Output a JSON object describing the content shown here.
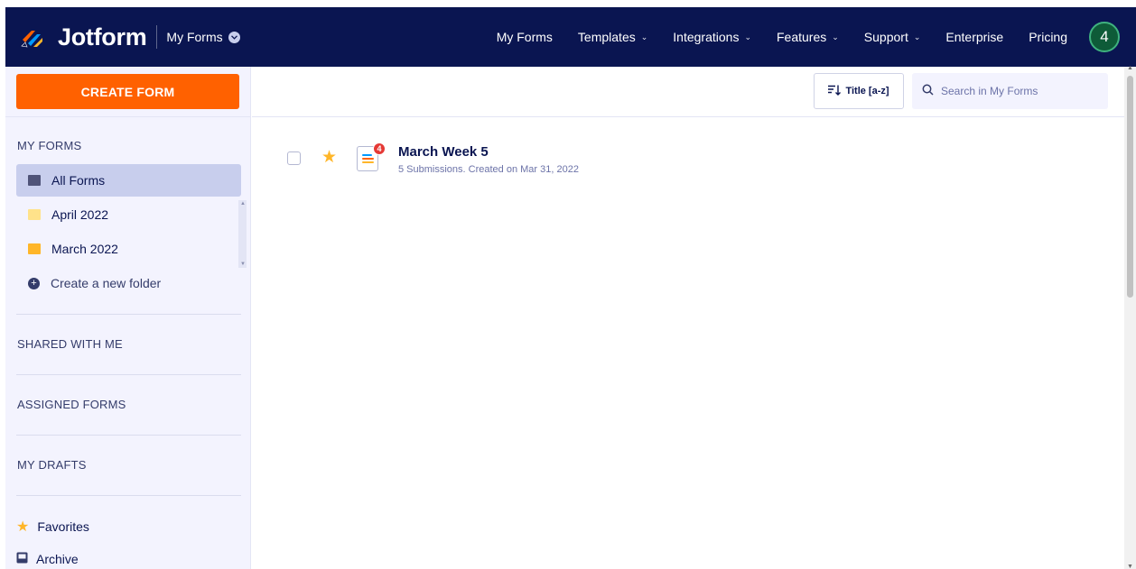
{
  "header": {
    "brand": "Jotform",
    "context_title": "My Forms",
    "nav": [
      {
        "label": "My Forms",
        "has_dropdown": false
      },
      {
        "label": "Templates",
        "has_dropdown": true
      },
      {
        "label": "Integrations",
        "has_dropdown": true
      },
      {
        "label": "Features",
        "has_dropdown": true
      },
      {
        "label": "Support",
        "has_dropdown": true
      },
      {
        "label": "Enterprise",
        "has_dropdown": false
      },
      {
        "label": "Pricing",
        "has_dropdown": false
      }
    ],
    "avatar_text": "4"
  },
  "sidebar": {
    "create_button": "CREATE FORM",
    "my_forms_label": "MY FORMS",
    "folders": [
      {
        "label": "All Forms",
        "active": true
      },
      {
        "label": "April 2022",
        "active": false
      },
      {
        "label": "March 2022",
        "active": false
      }
    ],
    "create_folder": "Create a new folder",
    "sections": [
      "SHARED WITH ME",
      "ASSIGNED FORMS",
      "MY DRAFTS"
    ],
    "favorites": "Favorites",
    "archive": "Archive"
  },
  "toolbar": {
    "sort_label": "Title [a-z]",
    "search_placeholder": "Search in My Forms"
  },
  "forms": [
    {
      "title": "March Week 5",
      "meta": "5 Submissions. Created on Mar 31, 2022",
      "badge": "4",
      "favorite": true
    }
  ],
  "colors": {
    "navy": "#0a1551",
    "orange": "#ff6100",
    "sidebar_bg": "#f3f3fe",
    "active_item": "#c8ceed",
    "star": "#ffb629",
    "badge": "#e53935"
  }
}
